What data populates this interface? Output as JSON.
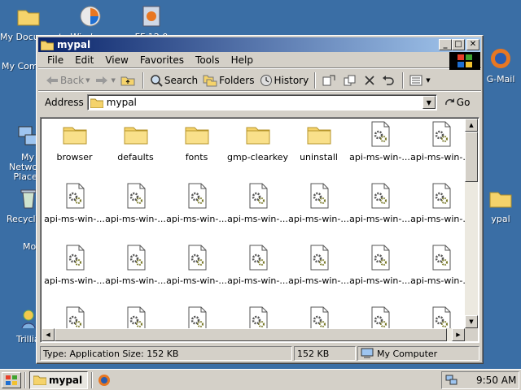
{
  "desktop": {
    "icons": [
      {
        "label": "My Documents"
      },
      {
        "label": "Windows"
      },
      {
        "label": "FF 12.0"
      },
      {
        "label": "My Comp"
      },
      {
        "label": "My Network Places"
      },
      {
        "label": "Recycle"
      },
      {
        "label": "Mo"
      },
      {
        "label": "Trillian"
      },
      {
        "label": "G-Mail"
      },
      {
        "label": "ypal"
      }
    ]
  },
  "window": {
    "title": "mypal",
    "menu": [
      "File",
      "Edit",
      "View",
      "Favorites",
      "Tools",
      "Help"
    ],
    "toolbar": {
      "back": "Back",
      "search": "Search",
      "folders": "Folders",
      "history": "History"
    },
    "address": {
      "label": "Address",
      "value": "mypal",
      "go": "Go"
    },
    "files": [
      {
        "name": "browser",
        "type": "folder"
      },
      {
        "name": "defaults",
        "type": "folder"
      },
      {
        "name": "fonts",
        "type": "folder"
      },
      {
        "name": "gmp-clearkey",
        "type": "folder"
      },
      {
        "name": "uninstall",
        "type": "folder"
      },
      {
        "name": "api-ms-win-...",
        "type": "dll"
      },
      {
        "name": "api-ms-win-...",
        "type": "dll"
      },
      {
        "name": "api-ms-win-...",
        "type": "dll"
      },
      {
        "name": "api-ms-win-...",
        "type": "dll"
      },
      {
        "name": "api-ms-win-...",
        "type": "dll"
      },
      {
        "name": "api-ms-win-...",
        "type": "dll"
      },
      {
        "name": "api-ms-win-...",
        "type": "dll"
      },
      {
        "name": "api-ms-win-...",
        "type": "dll"
      },
      {
        "name": "api-ms-win-...",
        "type": "dll"
      },
      {
        "name": "api-ms-win-...",
        "type": "dll"
      },
      {
        "name": "api-ms-win-...",
        "type": "dll"
      },
      {
        "name": "api-ms-win-...",
        "type": "dll"
      },
      {
        "name": "api-ms-win-...",
        "type": "dll"
      },
      {
        "name": "api-ms-win-...",
        "type": "dll"
      },
      {
        "name": "api-ms-win-...",
        "type": "dll"
      },
      {
        "name": "api-ms-win-...",
        "type": "dll"
      },
      {
        "name": "",
        "type": "dll"
      },
      {
        "name": "",
        "type": "dll"
      },
      {
        "name": "",
        "type": "dll"
      },
      {
        "name": "",
        "type": "dll"
      },
      {
        "name": "",
        "type": "dll"
      },
      {
        "name": "",
        "type": "dll"
      },
      {
        "name": "",
        "type": "dll"
      }
    ],
    "status": {
      "info": "Type: Application Size: 152 KB",
      "size": "152 KB",
      "zone": "My Computer"
    }
  },
  "taskbar": {
    "task_label": "mypal",
    "clock": "9:50 AM"
  },
  "colors": {
    "desktop": "#3a6ea5",
    "title_start": "#0a246a",
    "title_end": "#a6caf0",
    "folder": "#f5d36b"
  }
}
